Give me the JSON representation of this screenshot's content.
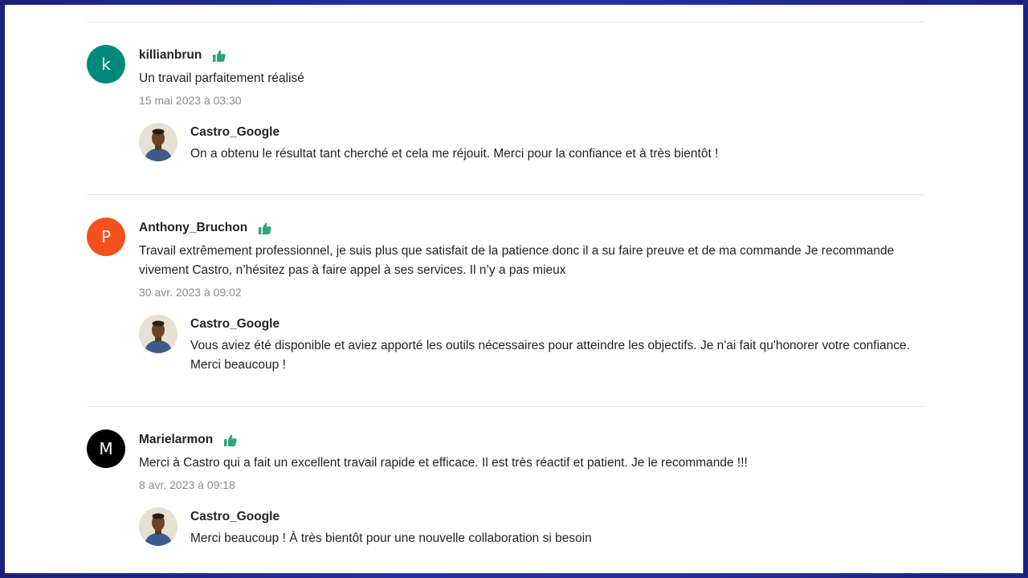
{
  "reviews": [
    {
      "initial": "k",
      "avatar_color": "#00897b",
      "username": "killianbrun",
      "text": "Un travail parfaitement réalisé",
      "date": "15 mai 2023 à 03:30",
      "reply": {
        "name": "Castro_Google",
        "text": "On a obtenu le résultat tant cherché et cela me réjouit. Merci pour la confiance et à très bientôt !"
      }
    },
    {
      "initial": "P",
      "avatar_color": "#f4511e",
      "username": "Anthony_Bruchon",
      "text": "Travail extrêmement professionnel, je suis plus que satisfait de la patience donc il a su faire preuve et de ma commande Je recommande vivement Castro, n’hésitez pas à faire appel à ses services. Il n’y a pas mieux",
      "date": "30 avr. 2023 à 09:02",
      "reply": {
        "name": "Castro_Google",
        "text": "Vous aviez été disponible et aviez apporté les outils nécessaires pour atteindre les objectifs. Je n'ai fait qu'honorer votre confiance. Merci beaucoup !"
      }
    },
    {
      "initial": "M",
      "avatar_color": "#000000",
      "username": "Marielarmon",
      "text": "Merci à Castro qui a fait un excellent travail rapide et efficace. Il est très réactif et patient. Je le recommande !!!",
      "date": "8 avr. 2023 à 09:18",
      "reply": {
        "name": "Castro_Google",
        "text": "Merci beaucoup ! À très bientôt pour une nouvelle collaboration si besoin"
      }
    }
  ],
  "icons": {
    "thumbs_up": "thumbs-up-icon",
    "thumbs_up_color": "#2fa37c"
  }
}
